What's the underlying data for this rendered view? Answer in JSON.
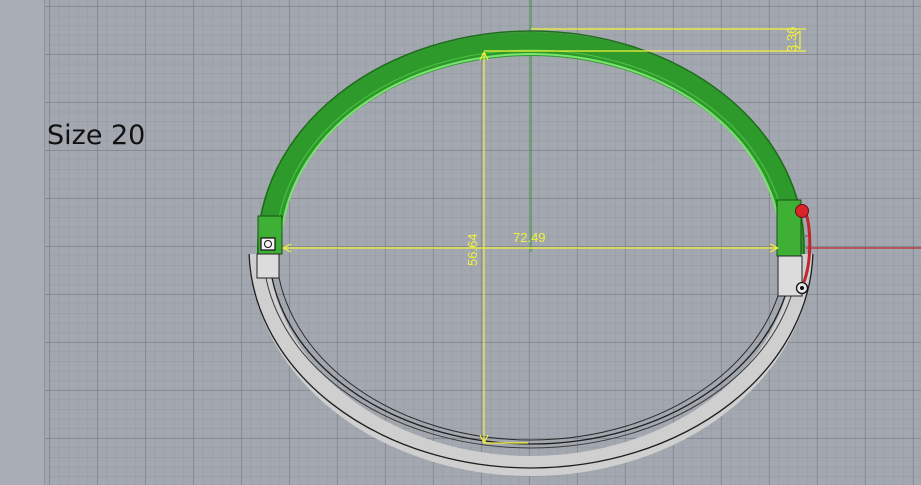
{
  "viewport": {
    "label": "Size 20",
    "dimensions": {
      "width": "72.49",
      "height": "56.64",
      "thickness": "3.36"
    }
  },
  "colors": {
    "background": "#a3a8b0",
    "green_band": "#2f9a2c",
    "silver_band": "#c9c9c9",
    "dimension": "#f2f23a",
    "x_axis": "#c0262b",
    "y_axis": "#2aa02a",
    "hinge_marker": "#d9252a"
  }
}
